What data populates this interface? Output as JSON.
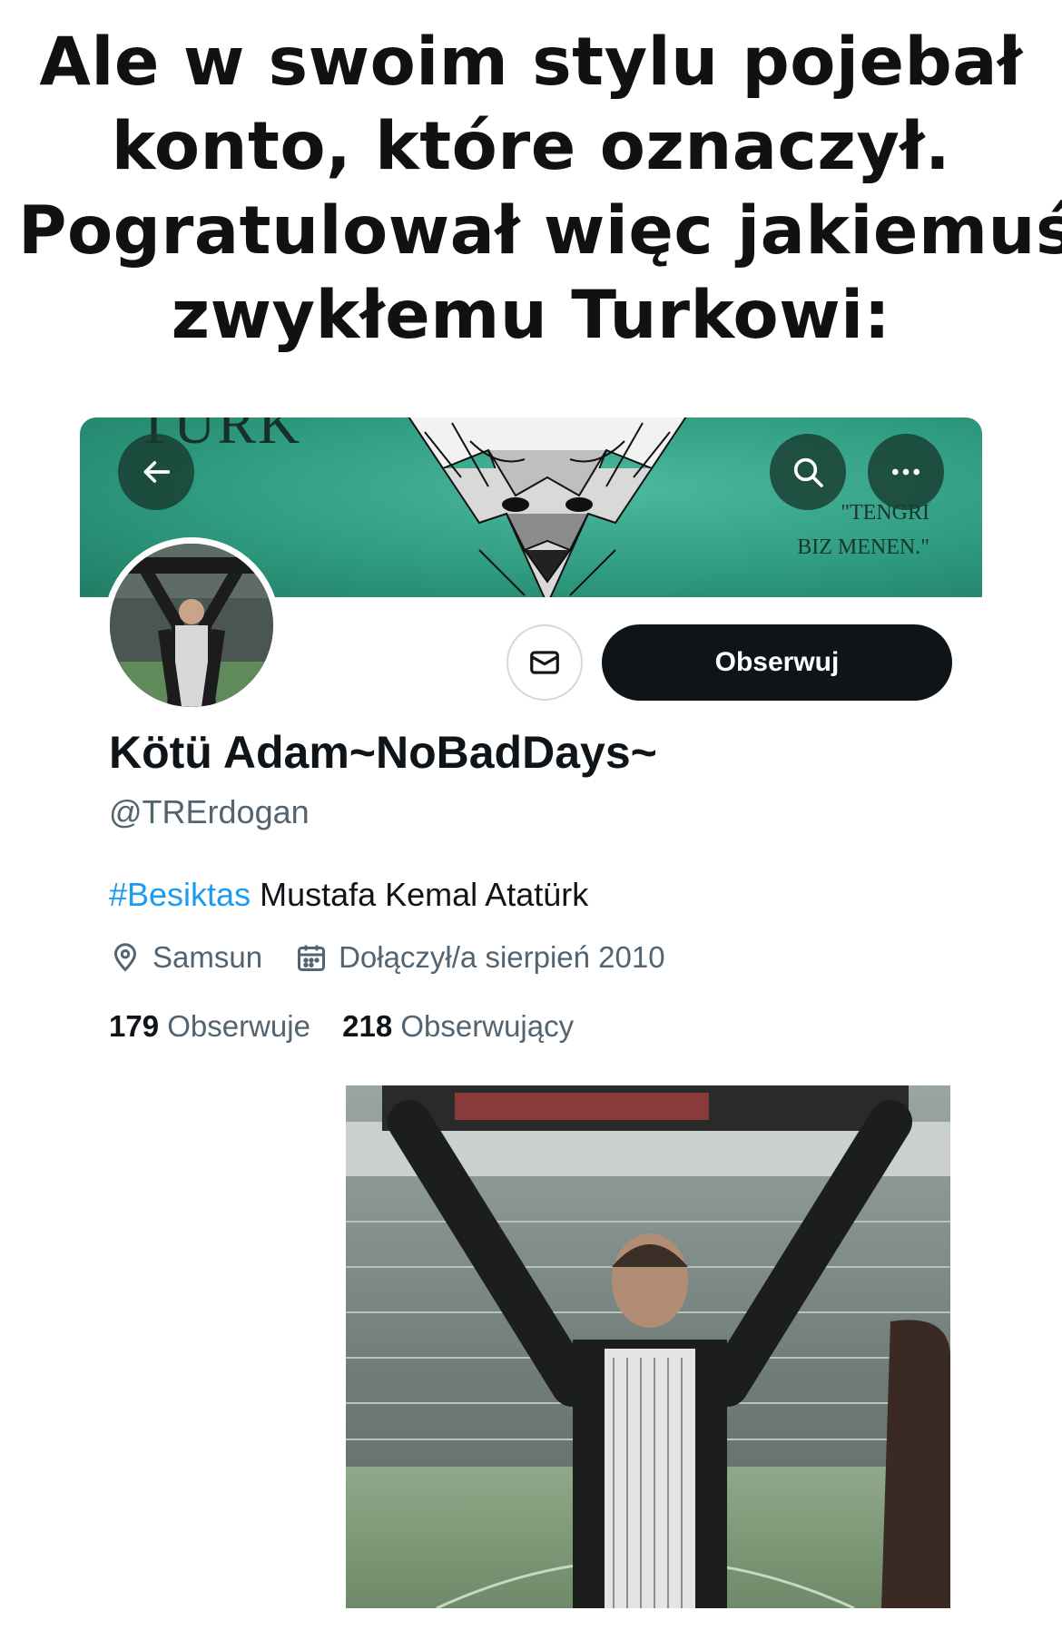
{
  "caption": {
    "lines": [
      "Ale w swoim stylu pojebał",
      "konto, które oznaczył.",
      "Pogratulował więc jakiemuś",
      "zwykłemu Turkowi:"
    ]
  },
  "banner": {
    "turk_text": "TURK",
    "quote_line1": "\"TENGRI",
    "quote_line2": "BIZ MENEN.\"",
    "color": "#2f9b80"
  },
  "header_buttons": {
    "back_icon": "arrow-left-icon",
    "search_icon": "search-icon",
    "more_icon": "more-icon"
  },
  "profile": {
    "follow_label": "Obserwuj",
    "message_icon": "mail-icon",
    "display_name": "Kötü Adam~NoBadDays~",
    "handle": "@TRErdogan",
    "bio_hashtag": "#Besiktas",
    "bio_text": " Mustafa Kemal Atatürk",
    "location": "Samsun",
    "joined": "Dołączył/a sierpień 2010",
    "following_count": "179",
    "following_label": "Obserwuje",
    "followers_count": "218",
    "followers_label": "Obserwujący",
    "accent_color": "#1d9bf0"
  }
}
